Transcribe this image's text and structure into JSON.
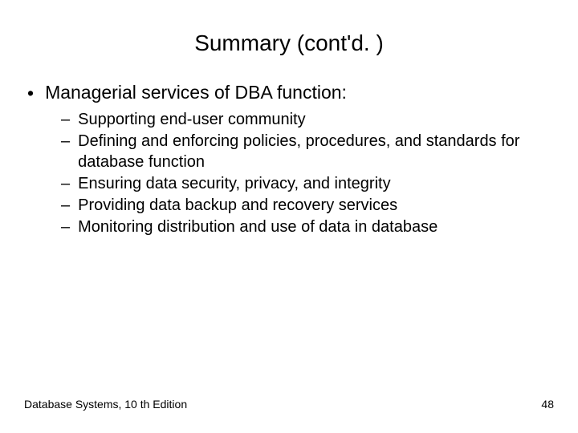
{
  "title": "Summary (cont'd. )",
  "main_bullet": "Managerial services of DBA function:",
  "sub_bullets": [
    "Supporting end-user community",
    "Defining and enforcing policies, procedures, and standards for database function",
    "Ensuring data security, privacy, and integrity",
    "Providing data backup and recovery services",
    "Monitoring distribution and use of data in database"
  ],
  "footer_left": "Database Systems, 10 th Edition",
  "footer_right": "48"
}
